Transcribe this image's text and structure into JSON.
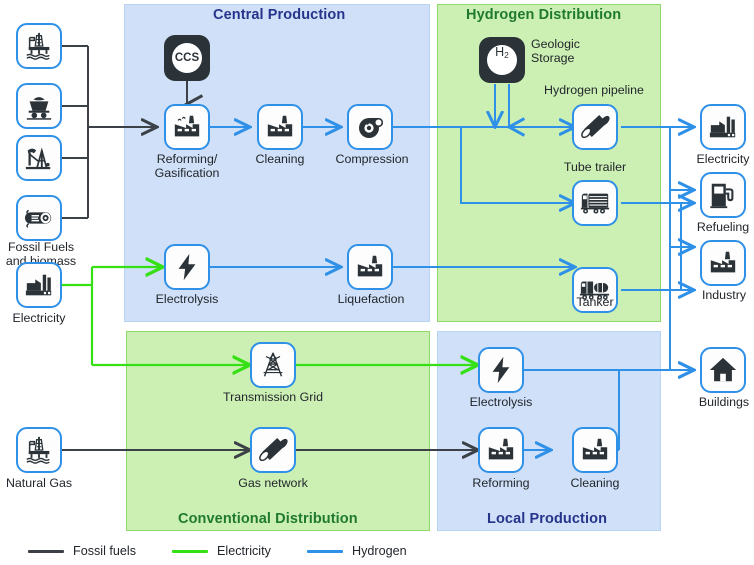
{
  "panels": [
    {
      "key": "central_production",
      "title": "Central Production",
      "color": "#cfe0f8",
      "title_color": "#27348b"
    },
    {
      "key": "hydrogen_distribution",
      "title": "Hydrogen Distribution",
      "color": "#ccf0b4",
      "title_color": "#1f7a2f"
    },
    {
      "key": "conventional_distribution",
      "title": "Conventional Distribution",
      "color": "#ccf0b4",
      "title_color": "#1f7a2f"
    },
    {
      "key": "local_production",
      "title": "Local Production",
      "color": "#cfe0f8",
      "title_color": "#27348b"
    }
  ],
  "sources": {
    "fossil_label": "Fossil Fuels\nand biomass",
    "electricity_label": "Electricity",
    "natural_gas_label": "Natural Gas",
    "icons": [
      "offshore-rig-icon",
      "coal-cart-icon",
      "oil-pumpjack-icon",
      "log-biomass-icon",
      "power-plant-icon",
      "offshore-rig-icon"
    ]
  },
  "nodes": {
    "ccs": "CCS",
    "reforming_gasification": "Reforming/\nGasification",
    "cleaning_central": "Cleaning",
    "compression": "Compression",
    "electrolysis_central": "Electrolysis",
    "liquefaction": "Liquefaction",
    "geologic_storage": "Geologic\nStorage",
    "geologic_storage_symbol": "H",
    "geologic_storage_subscript": "2",
    "hydrogen_pipeline": "Hydrogen pipeline",
    "tube_trailer": "Tube trailer",
    "tanker": "Tanker",
    "transmission_grid": "Transmission Grid",
    "gas_network": "Gas network",
    "electrolysis_local": "Electrolysis",
    "reforming_local": "Reforming",
    "cleaning_local": "Cleaning"
  },
  "end_uses": [
    {
      "key": "electricity",
      "label": "Electricity",
      "icon": "power-plant-icon"
    },
    {
      "key": "refueling",
      "label": "Refueling",
      "icon": "fuel-pump-icon"
    },
    {
      "key": "industry",
      "label": "Industry",
      "icon": "factory-icon"
    },
    {
      "key": "buildings",
      "label": "Buildings",
      "icon": "house-icon"
    }
  ],
  "legend": [
    {
      "key": "fossil_fuels",
      "label": "Fossil fuels",
      "color": "#3b4147"
    },
    {
      "key": "electricity",
      "label": "Electricity",
      "color": "#35e015"
    },
    {
      "key": "hydrogen",
      "label": "Hydrogen",
      "color": "#2f90e8"
    }
  ],
  "colors": {
    "fossil": "#3b4147",
    "electricity": "#35e015",
    "hydrogen": "#2f90e8",
    "panel_blue": "#cfe0f8",
    "panel_green": "#ccf0b4",
    "title_blue": "#27348b",
    "title_green": "#1f7a2f",
    "chip_border": "#2f90e8",
    "dark_chip": "#2b3338"
  }
}
